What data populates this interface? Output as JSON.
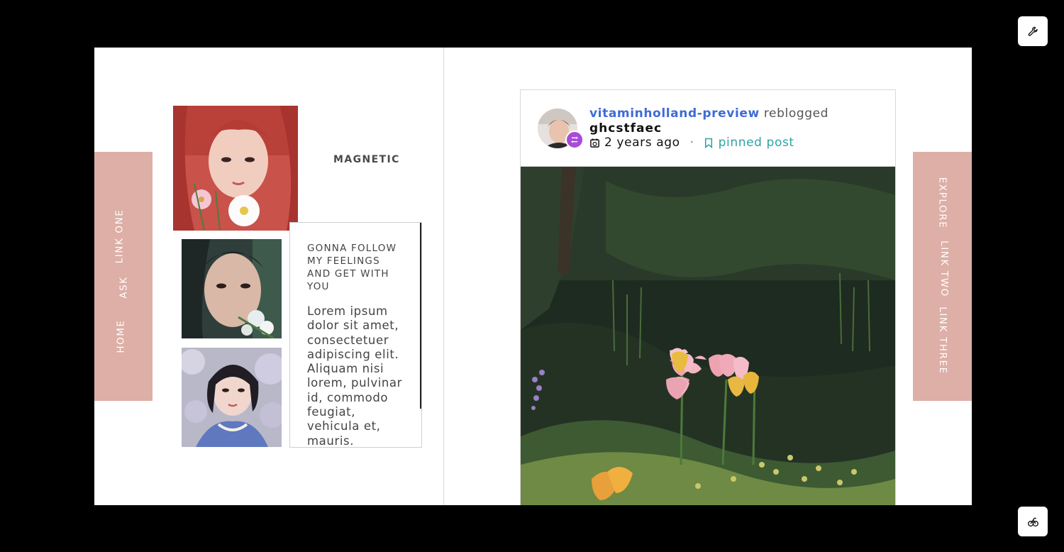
{
  "nav_left": {
    "links": [
      {
        "label": "Home"
      },
      {
        "label": "Ask"
      },
      {
        "label": "Link One"
      }
    ]
  },
  "nav_right": {
    "links": [
      {
        "label": "Explore"
      },
      {
        "label": "Link Two"
      },
      {
        "label": "Link Three"
      }
    ]
  },
  "sidebar": {
    "title": "MAGNETIC",
    "about_heading": "GONNA FOLLOW MY FEELINGS AND GET WITH YOU",
    "about_text": "Lorem ipsum dolor sit amet, consectetuer adipiscing elit. Aliquam nisi lorem, pulvinar id, commodo feugiat, vehicula et, mauris."
  },
  "post": {
    "reblogger": "vitaminholland-preview",
    "reblog_verb": "reblogged",
    "original_author": "ghcstfaec",
    "timestamp": "2 years ago",
    "separator": "·",
    "pinned_label": "pinned post"
  },
  "colors": {
    "nav_bg": "#ddafa6",
    "author_link": "#3f6bd6",
    "pinned": "#2ea3a3",
    "reblog_badge": "#a84bd8"
  },
  "icons": {
    "top_right_button": "wrench-icon",
    "bottom_right_button": "tumblr-logo-icon",
    "timestamp": "calendar-clock-icon",
    "pinned": "bookmark-icon",
    "reblog": "reblog-icon"
  }
}
